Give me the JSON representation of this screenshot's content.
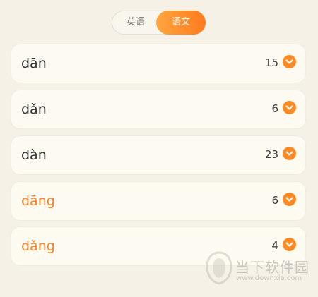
{
  "tabs": [
    {
      "label": "英语",
      "active": false
    },
    {
      "label": "语文",
      "active": true
    }
  ],
  "rows": [
    {
      "syllable": "dān",
      "count": "15",
      "highlighted": false
    },
    {
      "syllable": "dǎn",
      "count": "6",
      "highlighted": false
    },
    {
      "syllable": "dàn",
      "count": "23",
      "highlighted": false
    },
    {
      "syllable": "dāng",
      "count": "6",
      "highlighted": true
    },
    {
      "syllable": "dǎng",
      "count": "4",
      "highlighted": true
    }
  ],
  "watermark": {
    "name": "当下软件园",
    "url": "www.downxia.com"
  },
  "colors": {
    "accent": "#ff7f1e",
    "background": "#f6f1e6",
    "card": "#fdfaf1",
    "text": "#333333"
  },
  "icons": {
    "expand": "chevron-down-icon",
    "watermark_logo": "watermark-logo-icon"
  }
}
